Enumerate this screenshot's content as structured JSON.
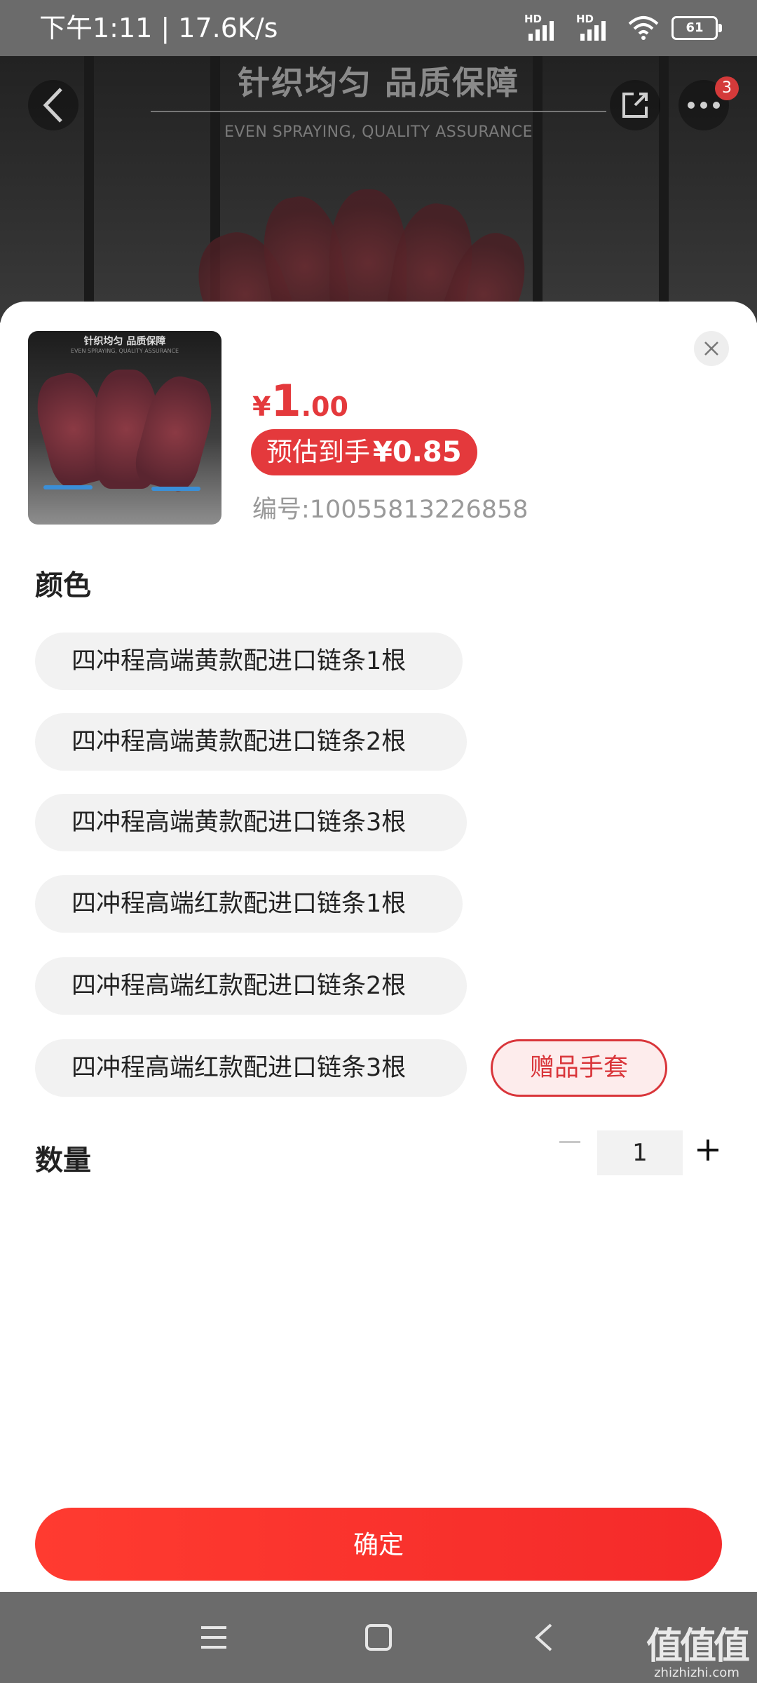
{
  "status_bar": {
    "time_speed": "下午1:11 | 17.6K/s",
    "signal_1_label": "HD",
    "signal_2_label": "HD",
    "battery": "61"
  },
  "hero": {
    "title": "针织均匀 品质保障",
    "subtitle": "EVEN SPRAYING, QUALITY ASSURANCE",
    "cart_badge": "3"
  },
  "product": {
    "thumb_title": "针织均匀 品质保障",
    "thumb_subtitle": "EVEN SPRAYING, QUALITY ASSURANCE",
    "currency": "¥",
    "price_int": "1",
    "price_dec": ".00",
    "estimate_label": "预估到手",
    "estimate_value": "¥0.85",
    "sku": "编号:10055813226858"
  },
  "color_section": {
    "label": "颜色",
    "options": [
      "四冲程高端黄款配进口链条1根",
      "四冲程高端黄款配进口链条2根",
      "四冲程高端黄款配进口链条3根",
      "四冲程高端红款配进口链条1根",
      "四冲程高端红款配进口链条2根",
      "四冲程高端红款配进口链条3根"
    ],
    "gift_option": "赠品手套"
  },
  "quantity": {
    "label": "数量",
    "value": "1"
  },
  "confirm_label": "确定",
  "watermark": {
    "big": "值值值",
    "small": "zhizhizhi.com"
  },
  "colors": {
    "accent_red": "#e4393c",
    "status_bar": "#6b6b6b"
  }
}
